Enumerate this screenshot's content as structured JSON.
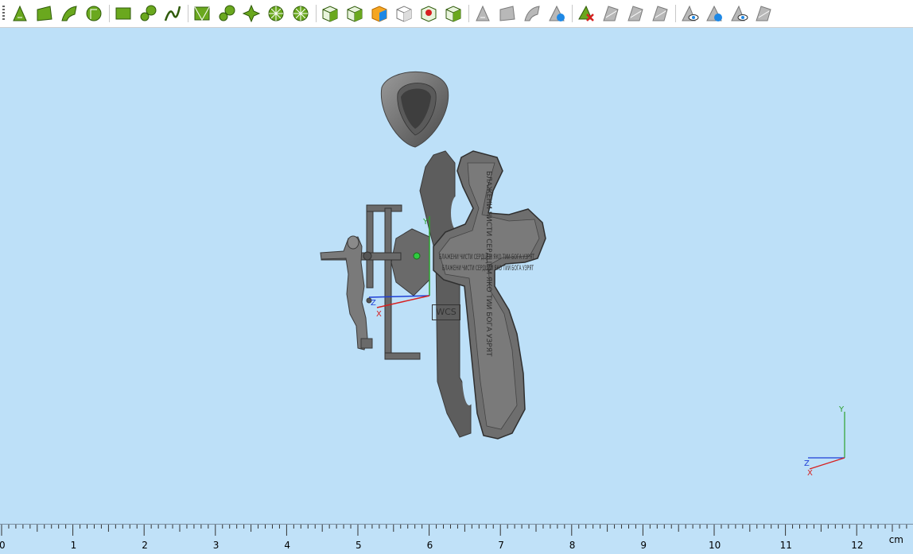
{
  "toolbar": {
    "groups": [
      [
        "triangle-tool-icon",
        "plane-tool-icon",
        "curve-plane-icon",
        "circle-tool-icon"
      ],
      [
        "rectangle-tool-icon",
        "knot-tool-icon",
        "spline-tool-icon"
      ],
      [
        "mesh-plane-icon",
        "nodes-tool-icon",
        "cross-tool-icon",
        "wheel-tool-icon",
        "wheel-cut-icon"
      ],
      [
        "solid-box-icon",
        "solid-cut-icon",
        "solid-color-icon",
        "solid-outline-icon",
        "solid-red-icon",
        "solid-green-icon"
      ],
      [
        "gray-triangle-icon",
        "gray-plane-icon",
        "gray-arrow-icon",
        "blue-plane-icon"
      ],
      [
        "delete-object-icon",
        "gray-split-icon",
        "gray-copy-icon",
        "gray-shape-icon"
      ],
      [
        "eye-plane-icon",
        "eye-blue-icon",
        "eye-triangle-icon",
        "hide-plane-icon"
      ]
    ]
  },
  "viewport": {
    "wcs_label": "WCS",
    "cross_text": "БЛАЖЕНИ ЧИСТИ СЕРДЦЕМ ЯКО ТИИ БОГА УЗРЯТ",
    "mini_axes": {
      "y": "Y",
      "z": "Z",
      "x": "X"
    },
    "main_axes": {
      "y": "Y",
      "z": "Z",
      "x": "X"
    }
  },
  "ruler": {
    "unit": "cm",
    "labels": [
      "0",
      "1",
      "2",
      "3",
      "4",
      "5",
      "6",
      "7",
      "8",
      "9",
      "10",
      "11",
      "12"
    ]
  },
  "colors": {
    "background": "#bde0f8",
    "model": "#6e6e6e",
    "axis_y": "#2ca02c",
    "axis_z": "#1f3fd6",
    "axis_x": "#d62020"
  }
}
